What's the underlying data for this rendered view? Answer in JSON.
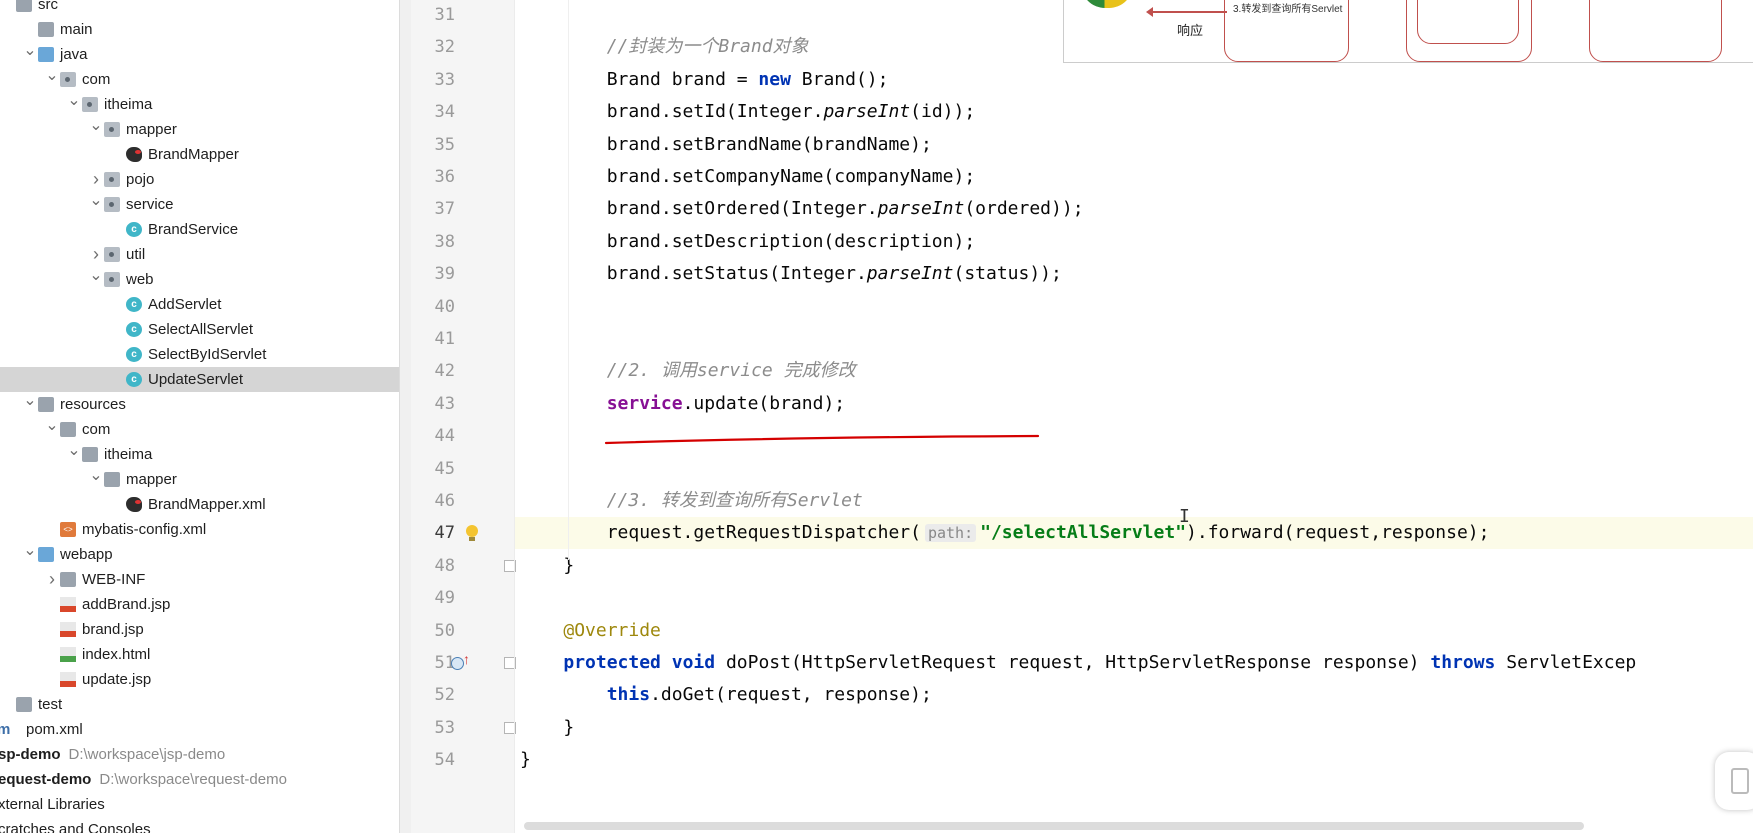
{
  "tree": [
    {
      "label": "src",
      "indent": 0,
      "arrow": "",
      "icon": "folder-gray",
      "name": "tree-item-src"
    },
    {
      "label": "main",
      "indent": 1,
      "arrow": "",
      "icon": "folder-gray",
      "name": "tree-item-main"
    },
    {
      "label": "java",
      "indent": 1,
      "arrow": "v",
      "icon": "folder-blue",
      "name": "tree-item-java"
    },
    {
      "label": "com",
      "indent": 2,
      "arrow": "v",
      "icon": "pkg",
      "name": "tree-item-com"
    },
    {
      "label": "itheima",
      "indent": 3,
      "arrow": "v",
      "icon": "pkg",
      "name": "tree-item-itheima"
    },
    {
      "label": "mapper",
      "indent": 4,
      "arrow": "v",
      "icon": "pkg",
      "name": "tree-item-mapper"
    },
    {
      "label": "BrandMapper",
      "indent": 5,
      "arrow": "",
      "icon": "bird",
      "name": "tree-item-brandmapper"
    },
    {
      "label": "pojo",
      "indent": 4,
      "arrow": ">",
      "icon": "pkg",
      "name": "tree-item-pojo"
    },
    {
      "label": "service",
      "indent": 4,
      "arrow": "v",
      "icon": "pkg",
      "name": "tree-item-service"
    },
    {
      "label": "BrandService",
      "indent": 5,
      "arrow": "",
      "icon": "cls",
      "name": "tree-item-brandservice"
    },
    {
      "label": "util",
      "indent": 4,
      "arrow": ">",
      "icon": "pkg",
      "name": "tree-item-util"
    },
    {
      "label": "web",
      "indent": 4,
      "arrow": "v",
      "icon": "pkg",
      "name": "tree-item-web"
    },
    {
      "label": "AddServlet",
      "indent": 5,
      "arrow": "",
      "icon": "cls",
      "name": "tree-item-addservlet"
    },
    {
      "label": "SelectAllServlet",
      "indent": 5,
      "arrow": "",
      "icon": "cls",
      "name": "tree-item-selectallservlet"
    },
    {
      "label": "SelectByIdServlet",
      "indent": 5,
      "arrow": "",
      "icon": "cls",
      "name": "tree-item-selectbyidservlet"
    },
    {
      "label": "UpdateServlet",
      "indent": 5,
      "arrow": "",
      "icon": "cls",
      "name": "tree-item-updateservlet",
      "selected": true
    },
    {
      "label": "resources",
      "indent": 1,
      "arrow": "v",
      "icon": "folder-res",
      "name": "tree-item-resources"
    },
    {
      "label": "com",
      "indent": 2,
      "arrow": "v",
      "icon": "folder-gray",
      "name": "tree-item-res-com"
    },
    {
      "label": "itheima",
      "indent": 3,
      "arrow": "v",
      "icon": "folder-gray",
      "name": "tree-item-res-itheima"
    },
    {
      "label": "mapper",
      "indent": 4,
      "arrow": "v",
      "icon": "folder-gray",
      "name": "tree-item-res-mapper"
    },
    {
      "label": "BrandMapper.xml",
      "indent": 5,
      "arrow": "",
      "icon": "bird",
      "name": "tree-item-brandmapper-xml"
    },
    {
      "label": "mybatis-config.xml",
      "indent": 2,
      "arrow": "",
      "icon": "xml",
      "name": "tree-item-mybatis-config"
    },
    {
      "label": "webapp",
      "indent": 1,
      "arrow": "v",
      "icon": "webapp",
      "name": "tree-item-webapp"
    },
    {
      "label": "WEB-INF",
      "indent": 2,
      "arrow": ">",
      "icon": "folder-gray",
      "name": "tree-item-web-inf"
    },
    {
      "label": "addBrand.jsp",
      "indent": 2,
      "arrow": "",
      "icon": "jsp",
      "name": "tree-item-addbrand-jsp"
    },
    {
      "label": "brand.jsp",
      "indent": 2,
      "arrow": "",
      "icon": "jsp",
      "name": "tree-item-brand-jsp"
    },
    {
      "label": "index.html",
      "indent": 2,
      "arrow": "",
      "icon": "html",
      "name": "tree-item-index-html"
    },
    {
      "label": "update.jsp",
      "indent": 2,
      "arrow": "",
      "icon": "jsp",
      "name": "tree-item-update-jsp"
    },
    {
      "label": "test",
      "indent": 0,
      "arrow": "",
      "icon": "folder-gray",
      "name": "tree-item-test"
    },
    {
      "label": "pom.xml",
      "indent": 0,
      "arrow": "",
      "icon": "",
      "name": "tree-item-pom",
      "prefix": "m"
    },
    {
      "label": "sp-demo",
      "indent": -1,
      "arrow": "",
      "icon": "",
      "name": "tree-item-jsp-demo",
      "bold": true,
      "path": "D:\\workspace\\jsp-demo"
    },
    {
      "label": "equest-demo",
      "indent": -1,
      "arrow": "",
      "icon": "",
      "name": "tree-item-request-demo",
      "bold": true,
      "path": "D:\\workspace\\request-demo"
    },
    {
      "label": "xternal Libraries",
      "indent": -1,
      "arrow": "",
      "icon": "",
      "name": "tree-item-external-libraries"
    },
    {
      "label": "cratches and Consoles",
      "indent": -1,
      "arrow": "",
      "icon": "",
      "name": "tree-item-scratches"
    }
  ],
  "editor": {
    "line_numbers": [
      "31",
      "32",
      "33",
      "34",
      "35",
      "36",
      "37",
      "38",
      "39",
      "40",
      "41",
      "42",
      "43",
      "44",
      "45",
      "46",
      "47",
      "48",
      "49",
      "50",
      "51",
      "52",
      "53",
      "54"
    ],
    "current_line": "47",
    "lines": [
      [],
      [
        {
          "t": "        "
        },
        {
          "t": "//封装为一个Brand对象",
          "c": "c-com"
        }
      ],
      [
        {
          "t": "        Brand brand = "
        },
        {
          "t": "new",
          "c": "c-kw"
        },
        {
          "t": " Brand();"
        }
      ],
      [
        {
          "t": "        brand.setId(Integer."
        },
        {
          "t": "parseInt",
          "c": "c-it"
        },
        {
          "t": "(id));"
        }
      ],
      [
        {
          "t": "        brand.setBrandName(brandName);"
        }
      ],
      [
        {
          "t": "        brand.setCompanyName(companyName);"
        }
      ],
      [
        {
          "t": "        brand.setOrdered(Integer."
        },
        {
          "t": "parseInt",
          "c": "c-it"
        },
        {
          "t": "(ordered));"
        }
      ],
      [
        {
          "t": "        brand.setDescription(description);"
        }
      ],
      [
        {
          "t": "        brand.setStatus(Integer."
        },
        {
          "t": "parseInt",
          "c": "c-it"
        },
        {
          "t": "(status));"
        }
      ],
      [],
      [],
      [
        {
          "t": "        "
        },
        {
          "t": "//2. 调用service 完成修改",
          "c": "c-com"
        }
      ],
      [
        {
          "t": "        "
        },
        {
          "t": "service",
          "c": "c-fld"
        },
        {
          "t": ".update(brand);"
        }
      ],
      [],
      [],
      [
        {
          "t": "        "
        },
        {
          "t": "//3. 转发到查询所有Servlet",
          "c": "c-com"
        }
      ],
      [
        {
          "t": "        request.getRequestDispatcher("
        },
        {
          "t": "path:",
          "c": "hint"
        },
        {
          "t": "\"/selectAllServlet\"",
          "c": "c-str"
        },
        {
          "t": ").forward(request,response);"
        }
      ],
      [
        {
          "t": "    }"
        }
      ],
      [],
      [
        {
          "t": "    "
        },
        {
          "t": "@Override",
          "c": "c-ann"
        }
      ],
      [
        {
          "t": "    "
        },
        {
          "t": "protected",
          "c": "c-kw"
        },
        {
          "t": " "
        },
        {
          "t": "void",
          "c": "c-kw"
        },
        {
          "t": " doPost(HttpServletRequest request, HttpServletResponse response) "
        },
        {
          "t": "throws",
          "c": "c-kw"
        },
        {
          "t": " ServletExcep"
        }
      ],
      [
        {
          "t": "        "
        },
        {
          "t": "this",
          "c": "c-kw"
        },
        {
          "t": ".doGet(request, response);"
        }
      ],
      [
        {
          "t": "    }"
        }
      ],
      [
        {
          "t": "}"
        }
      ]
    ]
  },
  "diagram": {
    "arrow_label": "3.转发到查询所有Servlet",
    "response_label": "响应"
  },
  "colors": {
    "annotation_red": "#d40000",
    "keyword": "#0033b3",
    "string": "#067d17",
    "field": "#871094",
    "comment": "#8c8c8c"
  }
}
